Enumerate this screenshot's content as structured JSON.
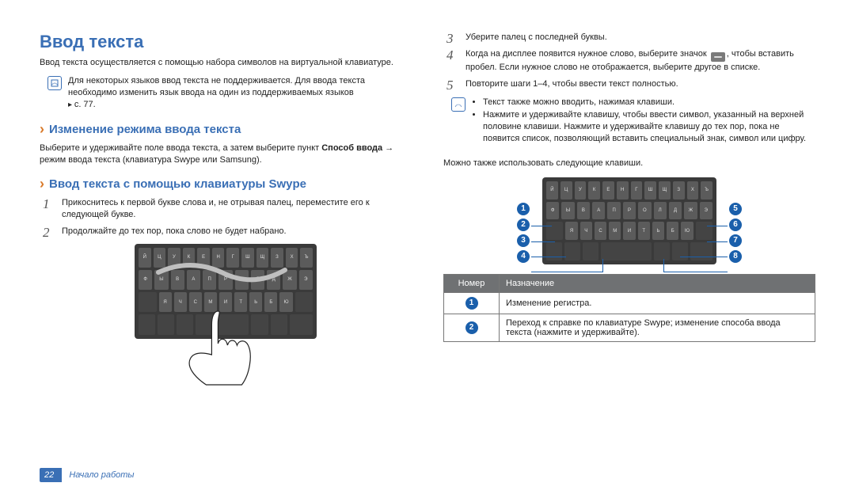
{
  "title": "Ввод текста",
  "intro": "Ввод текста осуществляется с помощью набора символов на виртуальной клавиатуре.",
  "note1": {
    "text": "Для некоторых языков ввод текста не поддерживается. Для ввода текста необходимо изменить язык ввода на один из поддерживаемых языков",
    "xref": "с. 77."
  },
  "section1_title": "Изменение режима ввода текста",
  "section1_body_part1": "Выберите и удерживайте поле ввода текста, а затем выберите пункт ",
  "section1_body_bold": "Способ ввода",
  "section1_body_part2": " → режим ввода текста (клавиатура Swype или Samsung).",
  "section2_title": "Ввод текста с помощью клавиатуры Swype",
  "steps_left": [
    "Прикоснитесь к первой букве слова и, не отрывая палец, переместите его к следующей букве.",
    "Продолжайте до тех пор, пока слово не будет набрано."
  ],
  "steps_right": [
    "Уберите палец с последней буквы.",
    "Когда на дисплее появится нужное слово, выберите значок ▯, чтобы вставить пробел. Если нужное слово не отображается, выберите другое в списке.",
    "Повторите шаги 1–4, чтобы ввести текст полностью."
  ],
  "note2_bullets": [
    "Текст также можно вводить, нажимая клавиши.",
    "Нажмите и удерживайте клавишу, чтобы ввести символ, указанный на верхней половине клавиши. Нажмите и удерживайте клавишу до тех пор, пока не появится список, позволяющий вставить специальный знак, символ или цифру."
  ],
  "after_note": "Можно также использовать следующие клавиши.",
  "kb_rows": [
    [
      "Й",
      "Ц",
      "У",
      "К",
      "Е",
      "Н",
      "Г",
      "Ш",
      "Щ",
      "З",
      "Х",
      "Ъ"
    ],
    [
      "Ф",
      "Ы",
      "В",
      "А",
      "П",
      "Р",
      "О",
      "Л",
      "Д",
      "Ж",
      "Э"
    ],
    [
      "Я",
      "Ч",
      "С",
      "М",
      "И",
      "Т",
      "Ь",
      "Б",
      "Ю"
    ]
  ],
  "table": {
    "headers": [
      "Номер",
      "Назначение"
    ],
    "rows": [
      {
        "num": "1",
        "desc": "Изменение регистра."
      },
      {
        "num": "2",
        "desc": "Переход к справке по клавиатуре Swype; изменение способа ввода текста (нажмите и удерживайте)."
      }
    ]
  },
  "callouts": {
    "left": [
      "1",
      "2",
      "3",
      "4"
    ],
    "right": [
      "5",
      "6",
      "7",
      "8"
    ]
  },
  "footer": {
    "page": "22",
    "chapter": "Начало работы"
  }
}
